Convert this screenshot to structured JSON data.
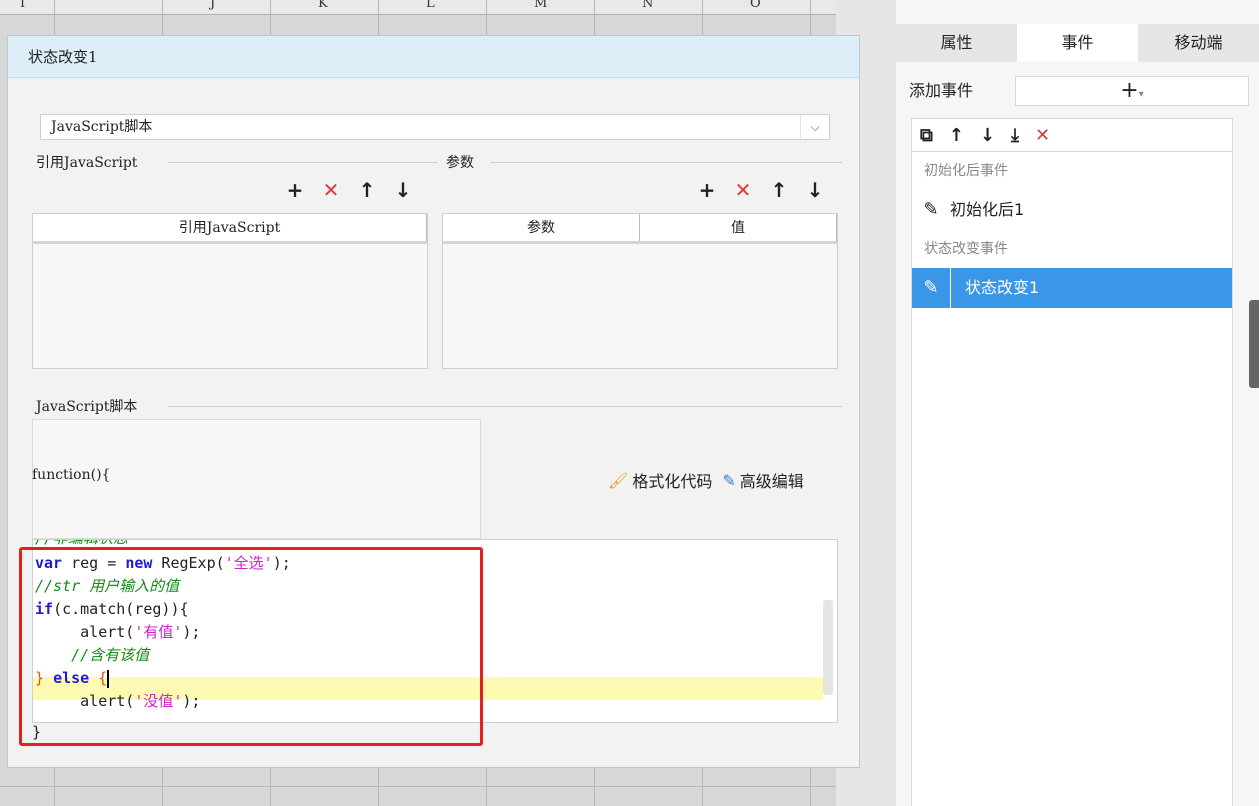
{
  "spreadsheet": {
    "columns": [
      "I",
      "J",
      "K",
      "L",
      "M",
      "N",
      "O"
    ]
  },
  "dialog": {
    "title": "状态改变1",
    "script_type": "JavaScript脚本",
    "ref_section_title": "引用JavaScript",
    "param_section_title": "参数",
    "ref_table_header": "引用JavaScript",
    "param_table_headers": [
      "参数",
      "值"
    ],
    "js_section_title": "JavaScript脚本",
    "function_signature": "function(){",
    "format_code_label": "格式化代码",
    "advanced_edit_label": "高级编辑",
    "closing_brace": "}",
    "code_top_partial": "//非编辑状态",
    "code_lines": [
      {
        "parts": [
          [
            "kw",
            "var"
          ],
          [
            "plain",
            " reg = "
          ],
          [
            "kw",
            "new"
          ],
          [
            "plain",
            " RegExp("
          ],
          [
            "str",
            "'全选'"
          ],
          [
            "plain",
            ");"
          ]
        ]
      },
      {
        "parts": [
          [
            "cm",
            "//str 用户输入的值"
          ]
        ]
      },
      {
        "parts": [
          [
            "kw",
            "if"
          ],
          [
            "plain",
            "(c.match(reg)){"
          ]
        ]
      },
      {
        "parts": [
          [
            "plain",
            "     alert("
          ],
          [
            "str",
            "'有值'"
          ],
          [
            "plain",
            ");"
          ]
        ]
      },
      {
        "parts": [
          [
            "cm",
            "    //含有该值"
          ]
        ]
      },
      {
        "parts": [
          [
            "br",
            "} "
          ],
          [
            "kw",
            "else"
          ],
          [
            "br",
            " {"
          ]
        ]
      },
      {
        "parts": [
          [
            "plain",
            "     alert("
          ],
          [
            "str",
            "'没值'"
          ],
          [
            "plain",
            ");"
          ]
        ]
      }
    ]
  },
  "panel": {
    "tabs": [
      "属性",
      "事件",
      "移动端"
    ],
    "active_tab": "事件",
    "add_event_label": "添加事件",
    "add_symbol": "+",
    "groups": [
      {
        "title": "初始化后事件",
        "items": [
          {
            "label": "初始化后1",
            "selected": false
          }
        ]
      },
      {
        "title": "状态改变事件",
        "items": [
          {
            "label": "状态改变1",
            "selected": true
          }
        ]
      }
    ]
  },
  "colors": {
    "selection": "#3a96e6",
    "delete_red": "#e03a3a",
    "title_bar": "#ddeef8",
    "highlight_line": "#fdfbb1",
    "annotation_red": "#e0221c"
  }
}
